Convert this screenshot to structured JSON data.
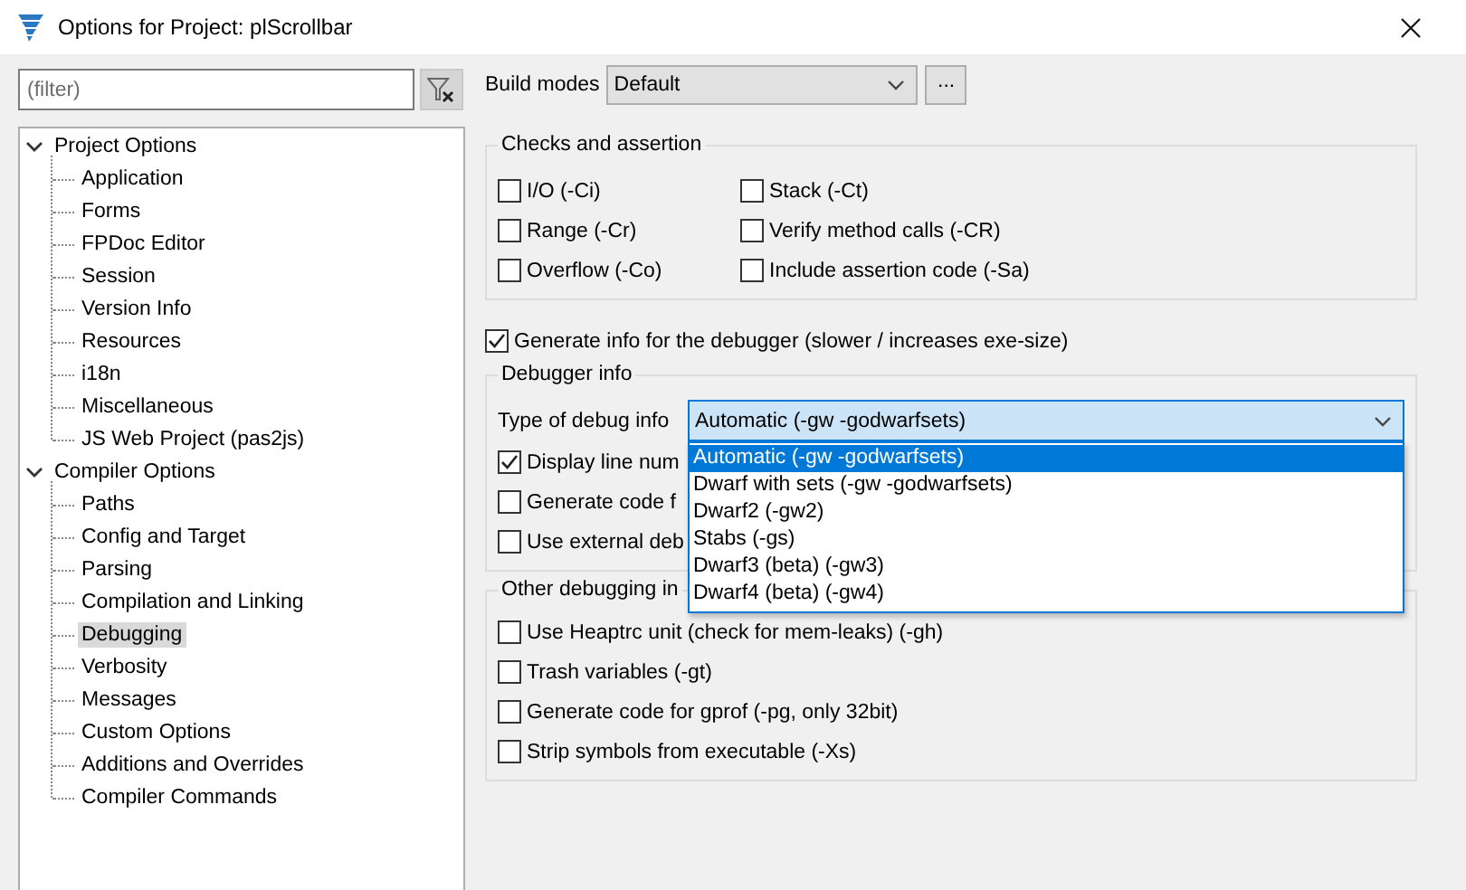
{
  "window": {
    "title": "Options for Project: plScrollbar"
  },
  "filter": {
    "placeholder": "(filter)"
  },
  "tree": [
    {
      "label": "Project Options",
      "expanded": true,
      "selected": false,
      "children": [
        {
          "label": "Application",
          "selected": false
        },
        {
          "label": "Forms",
          "selected": false
        },
        {
          "label": "FPDoc Editor",
          "selected": false
        },
        {
          "label": "Session",
          "selected": false
        },
        {
          "label": "Version Info",
          "selected": false
        },
        {
          "label": "Resources",
          "selected": false
        },
        {
          "label": "i18n",
          "selected": false
        },
        {
          "label": "Miscellaneous",
          "selected": false
        },
        {
          "label": "JS Web Project (pas2js)",
          "selected": false
        }
      ]
    },
    {
      "label": "Compiler Options",
      "expanded": true,
      "selected": false,
      "children": [
        {
          "label": "Paths",
          "selected": false
        },
        {
          "label": "Config and Target",
          "selected": false
        },
        {
          "label": "Parsing",
          "selected": false
        },
        {
          "label": "Compilation and Linking",
          "selected": false
        },
        {
          "label": "Debugging",
          "selected": true
        },
        {
          "label": "Verbosity",
          "selected": false
        },
        {
          "label": "Messages",
          "selected": false
        },
        {
          "label": "Custom Options",
          "selected": false
        },
        {
          "label": "Additions and Overrides",
          "selected": false
        },
        {
          "label": "Compiler Commands",
          "selected": false
        }
      ]
    }
  ],
  "build_modes": {
    "label": "Build modes",
    "value": "Default",
    "more_button": "..."
  },
  "checks": {
    "title": "Checks and assertion",
    "options": [
      {
        "label": "I/O (-Ci)",
        "checked": false
      },
      {
        "label": "Stack (-Ct)",
        "checked": false
      },
      {
        "label": "Range (-Cr)",
        "checked": false
      },
      {
        "label": "Verify method calls (-CR)",
        "checked": false
      },
      {
        "label": "Overflow (-Co)",
        "checked": false
      },
      {
        "label": "Include assertion code (-Sa)",
        "checked": false
      }
    ]
  },
  "generate_debug_info": {
    "label": "Generate info for the debugger (slower / increases exe-size)",
    "checked": true
  },
  "debugger_info": {
    "title": "Debugger info",
    "type_label": "Type of debug info",
    "type_value": "Automatic (-gw -godwarfsets)",
    "dropdown": [
      {
        "label": "Automatic (-gw -godwarfsets)",
        "selected": true
      },
      {
        "label": "Dwarf with sets (-gw -godwarfsets)",
        "selected": false
      },
      {
        "label": "Dwarf2 (-gw2)",
        "selected": false
      },
      {
        "label": "Stabs (-gs)",
        "selected": false
      },
      {
        "label": "Dwarf3 (beta) (-gw3)",
        "selected": false
      },
      {
        "label": "Dwarf4 (beta) (-gw4)",
        "selected": false
      }
    ],
    "options": [
      {
        "label": "Display line num",
        "checked": true
      },
      {
        "label": "Generate code f",
        "checked": false
      },
      {
        "label": "Use external deb",
        "checked": false
      }
    ]
  },
  "other_debugging": {
    "title": "Other debugging in",
    "options": [
      {
        "label": "Use Heaptrc unit (check for mem-leaks) (-gh)",
        "checked": false
      },
      {
        "label": "Trash variables (-gt)",
        "checked": false
      },
      {
        "label": "Generate code for gprof (-pg, only 32bit)",
        "checked": false
      },
      {
        "label": "Strip symbols from executable (-Xs)",
        "checked": false
      }
    ]
  }
}
